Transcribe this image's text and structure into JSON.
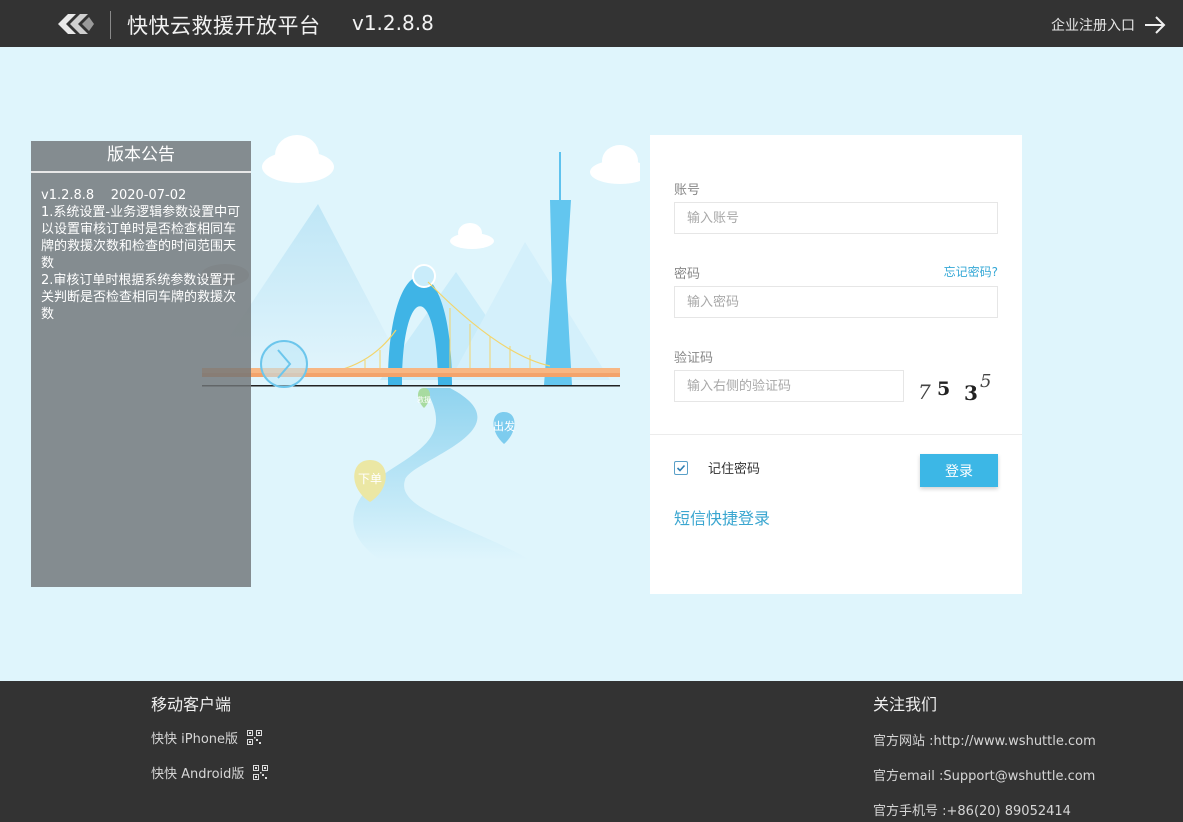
{
  "header": {
    "title": "快快云救援开放平台",
    "version": "v1.2.8.8",
    "enterprise_link": "企业注册入口"
  },
  "announcement": {
    "title": "版本公告",
    "lines": [
      "v1.2.8.8    2020-07-02",
      "1.系统设置-业务逻辑参数设置中可以设置审核订单时是否检查相同车牌的救援次数和检查的时间范围天数",
      "2.审核订单时根据系统参数设置开关判断是否检查相同车牌的救援次数"
    ]
  },
  "illustration": {
    "pin_order": "下单",
    "pin_depart": "出发",
    "pin_rescue": "救援"
  },
  "login": {
    "account_label": "账号",
    "account_placeholder": "输入账号",
    "password_label": "密码",
    "password_placeholder": "输入密码",
    "forgot_password": "忘记密码?",
    "captcha_label": "验证码",
    "captcha_placeholder": "输入右侧的验证码",
    "captcha_chars": [
      "7",
      "5",
      "3",
      "5"
    ],
    "remember_label": "记住密码",
    "remember_checked": true,
    "login_button": "登录",
    "sms_login": "短信快捷登录"
  },
  "footer": {
    "mobile_heading": "移动客户端",
    "iphone_label": "快快 iPhone版",
    "android_label": "快快 Android版",
    "follow_heading": "关注我们",
    "website": "官方网站 :http://www.wshuttle.com",
    "email": "官方email :Support@wshuttle.com",
    "phone": "官方手机号 :+86(20) 89052414"
  },
  "colors": {
    "header_bg": "#333333",
    "page_bg": "#dff5fc",
    "accent": "#3cb7e6",
    "link": "#3aa6d0"
  }
}
